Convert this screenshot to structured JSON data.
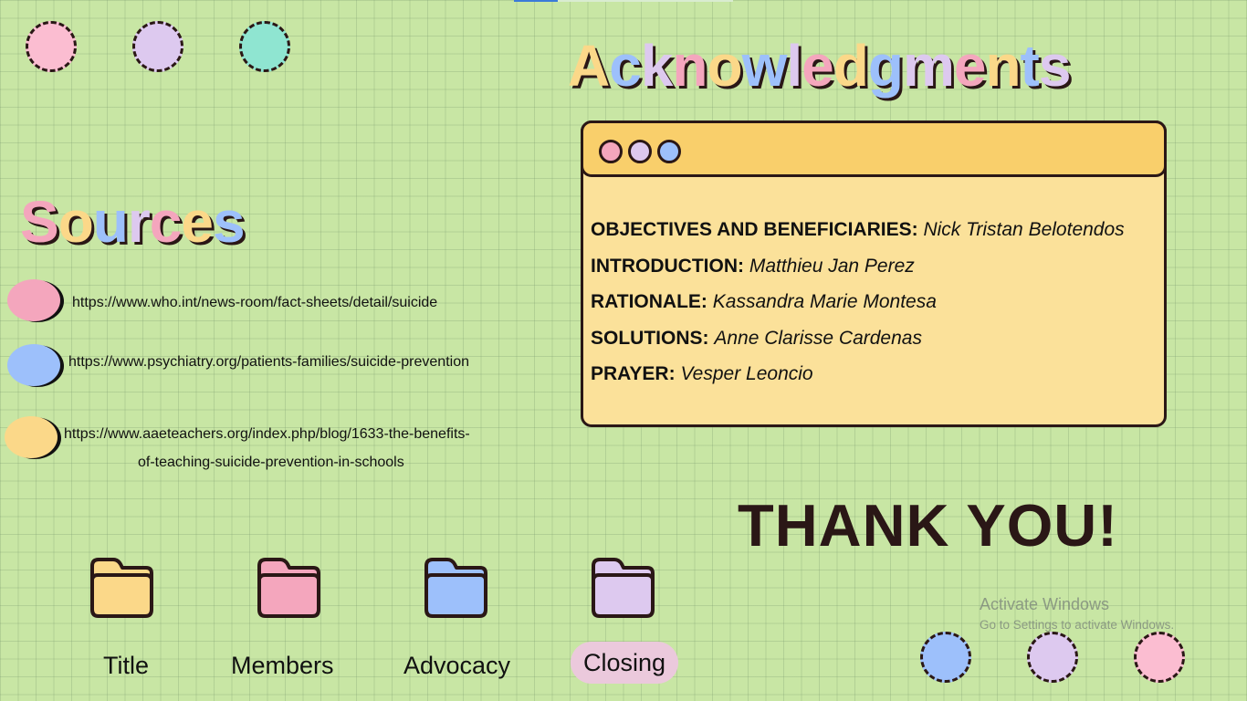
{
  "colors": {
    "background": "#c8e6a4",
    "ink": "#2a1716",
    "pink": "#f4a6bd",
    "lavender": "#ddc9ef",
    "mint": "#8fe5d1",
    "blue": "#9dc0fb",
    "yellow": "#fbd889",
    "window_header": "#f9cf6b",
    "window_body": "#fbe19a",
    "active_tab": "#ebc9dc"
  },
  "acknowledgments": {
    "title": "Acknowledgments",
    "credits": [
      {
        "role": "OBJECTIVES AND BENEFICIARIES:",
        "name": "Nick Tristan Belotendos"
      },
      {
        "role": "INTRODUCTION:",
        "name": "Matthieu Jan Perez"
      },
      {
        "role": "RATIONALE:",
        "name": "Kassandra Marie Montesa"
      },
      {
        "role": "SOLUTIONS:",
        "name": "Anne Clarisse Cardenas"
      },
      {
        "role": "PRAYER:",
        "name": "Vesper Leoncio"
      }
    ]
  },
  "sources": {
    "title": "Sources",
    "links": [
      {
        "url": "https://www.who.int/news-room/fact-sheets/detail/suicide"
      },
      {
        "url": "https://www.psychiatry.org/patients-families/suicide-prevention"
      },
      {
        "line1": "https://www.aaeteachers.org/index.php/blog/1633-the-benefits-",
        "line2": "of-teaching-suicide-prevention-in-schools"
      }
    ]
  },
  "closing": {
    "text": "THANK YOU!"
  },
  "nav": {
    "items": [
      {
        "label": "Title",
        "icon": "folder-icon",
        "color": "#fbd889"
      },
      {
        "label": "Members",
        "icon": "folder-icon",
        "color": "#f4a6bd"
      },
      {
        "label": "Advocacy",
        "icon": "folder-icon",
        "color": "#9dc0fb"
      },
      {
        "label": "Closing",
        "icon": "folder-icon",
        "color": "#ddc9ef",
        "active": true
      }
    ]
  },
  "watermark": {
    "line1": "Activate Windows",
    "line2": "Go to Settings to activate Windows."
  }
}
